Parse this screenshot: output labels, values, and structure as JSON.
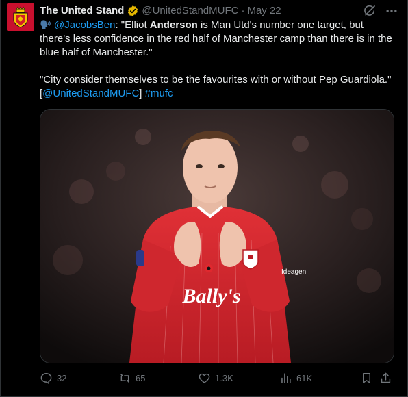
{
  "tweet": {
    "author": {
      "display_name": "The United Stand",
      "handle": "@UnitedStandMUFC",
      "separator": "·",
      "timestamp": "May 22",
      "verified": true,
      "avatar_icon": "crest-logo"
    },
    "body": {
      "p1": {
        "mention": "@JacobsBen",
        "text_a": ": \"Elliot ",
        "bold": "Anderson",
        "text_b": " is Man Utd's number one target, but there's less confidence in the red half of Manchester camp than there is in the blue half of Manchester.\""
      },
      "p2": {
        "text_a": "\"City consider themselves to be the favourites with or without Pep Guardiola.\" [",
        "mention": "@UnitedStandMUFC",
        "text_b": "] ",
        "hashtag": "#mufc"
      }
    },
    "media": {
      "shirt_sponsor": "Bally's",
      "shirt_badge_text": "Ideagen",
      "colors": {
        "shirt": "#d7252c",
        "background": "#1a1414"
      }
    },
    "actions": {
      "replies": "32",
      "retweets": "65",
      "likes": "1.3K",
      "views": "61K"
    },
    "colors": {
      "background": "#000000",
      "text": "#e7e9ea",
      "muted": "#71767b",
      "link": "#1d9bf0",
      "verified_badge": "#e6b800"
    }
  }
}
